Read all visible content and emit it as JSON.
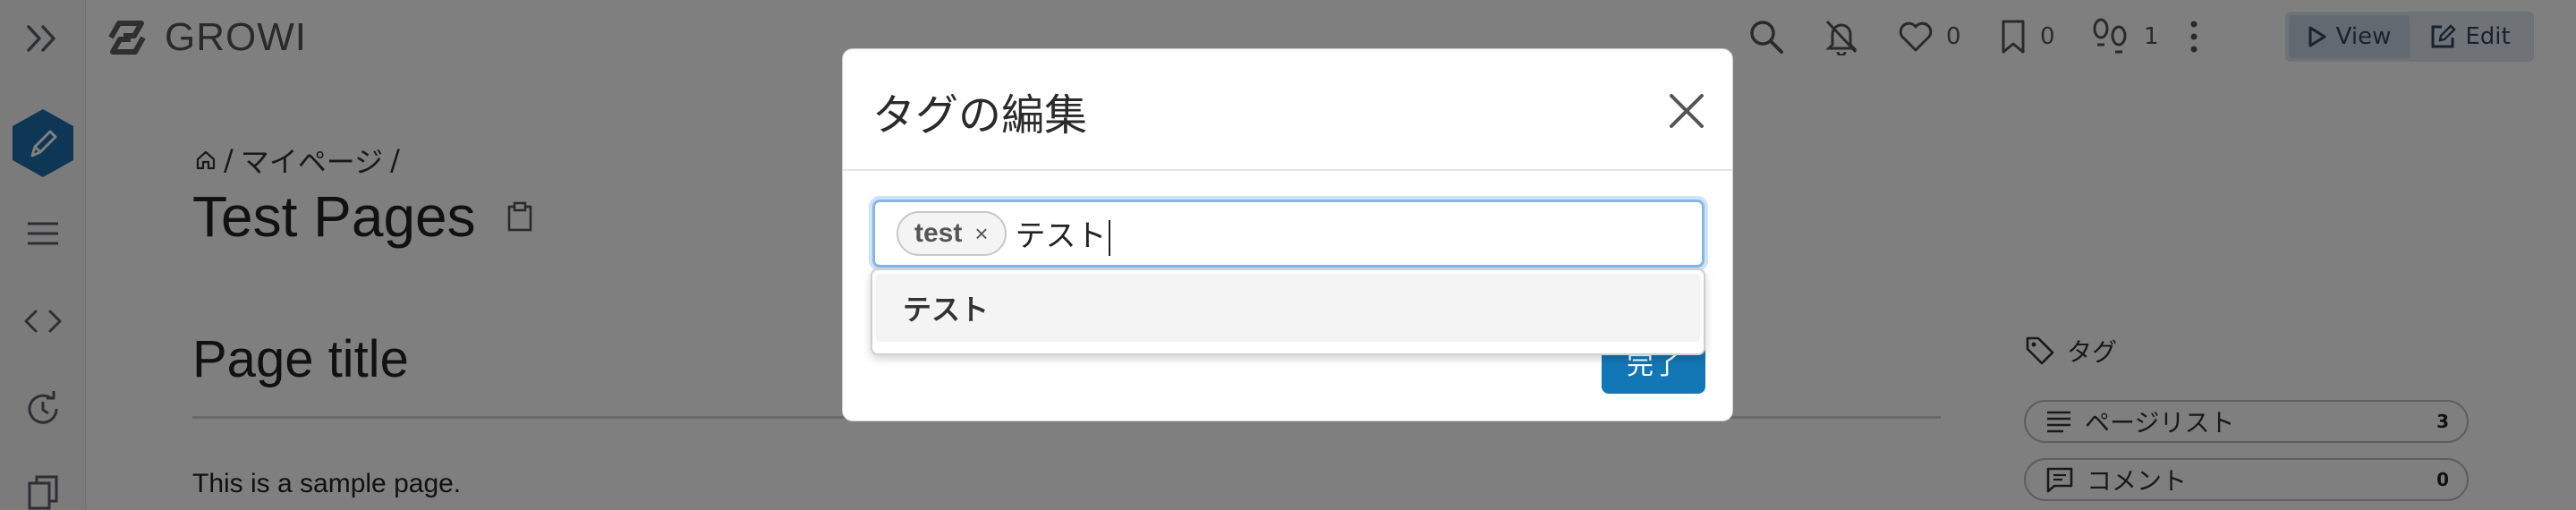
{
  "app": {
    "logo_text": "GROWI"
  },
  "sidebar": {
    "items": [
      {
        "icon": "double-chevron-right-icon"
      },
      {
        "icon": "pencil-edit-icon"
      },
      {
        "icon": "list-icon"
      },
      {
        "icon": "code-icon"
      },
      {
        "icon": "history-icon"
      },
      {
        "icon": "copy-icon"
      }
    ]
  },
  "topbar": {
    "like_count": "0",
    "bookmark_count": "0",
    "seen_count": "1",
    "view_label": "View",
    "edit_label": "Edit"
  },
  "page": {
    "breadcrumb_sep1": "/",
    "breadcrumb_item": "マイページ",
    "breadcrumb_sep2": "/",
    "title": "Test Pages",
    "content_title": "Page title",
    "content_text": "This is a sample page."
  },
  "side_panel": {
    "tags_label": "タグ",
    "pagelist_label": "ページリスト",
    "pagelist_count": "3",
    "comments_label": "コメント",
    "comments_count": "0"
  },
  "modal": {
    "title": "タグの編集",
    "tags": [
      "test"
    ],
    "chip_remove": "×",
    "typed_text": "テスト",
    "suggestion": "テスト",
    "done_label": "完了"
  },
  "colors": {
    "accent": "#1376b5",
    "overlay": "rgba(0,0,0,0.5)",
    "focus_ring": "#86b7e6"
  }
}
